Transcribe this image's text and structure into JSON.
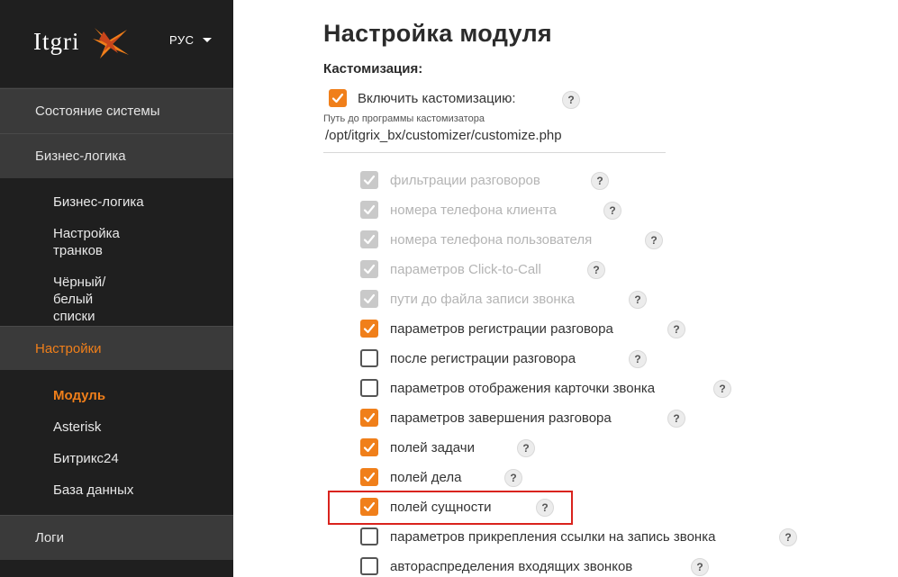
{
  "sidebar": {
    "logo_text": "Itgri",
    "lang": "РУС",
    "sections": [
      {
        "label": "Состояние системы"
      },
      {
        "label": "Бизнес-логика"
      },
      {
        "label": "Настройки"
      },
      {
        "label": "Логи"
      }
    ],
    "business_items": [
      {
        "label": "Бизнес-логика"
      },
      {
        "label": "Настройка транков"
      },
      {
        "label": "Чёрный/белый списки"
      }
    ],
    "settings_items": [
      {
        "label": "Модуль"
      },
      {
        "label": "Asterisk"
      },
      {
        "label": "Битрикс24"
      },
      {
        "label": "База данных"
      }
    ]
  },
  "main": {
    "title": "Настройка модуля",
    "section": "Кастомизация:",
    "enable": {
      "label": "Включить кастомизацию:",
      "checked": true
    },
    "path_label": "Путь до программы кастомизатора",
    "path_value": "/opt/itgrix_bx/customizer/customize.php",
    "help_glyph": "?",
    "options": [
      {
        "label": "фильтрации разговоров",
        "state": "disabled"
      },
      {
        "label": "номера телефона клиента",
        "state": "disabled"
      },
      {
        "label": "номера телефона пользователя",
        "state": "disabled"
      },
      {
        "label": "параметров Click-to-Call",
        "state": "disabled"
      },
      {
        "label": "пути до файла записи звонка",
        "state": "disabled"
      },
      {
        "label": "параметров регистрации разговора",
        "state": "checked"
      },
      {
        "label": "после регистрации разговора",
        "state": "unchecked"
      },
      {
        "label": "параметров отображения карточки звонка",
        "state": "unchecked"
      },
      {
        "label": "параметров завершения разговора",
        "state": "checked"
      },
      {
        "label": "полей задачи",
        "state": "checked"
      },
      {
        "label": "полей дела",
        "state": "checked"
      },
      {
        "label": "полей сущности",
        "state": "checked"
      },
      {
        "label": "параметров прикрепления ссылки на запись звонка",
        "state": "unchecked"
      },
      {
        "label": "автораспределения входящих звонков",
        "state": "unchecked"
      }
    ]
  },
  "colors": {
    "accent": "#f07f1a",
    "sidebar": "#1f1f1f",
    "highlight": "#d9231d"
  }
}
